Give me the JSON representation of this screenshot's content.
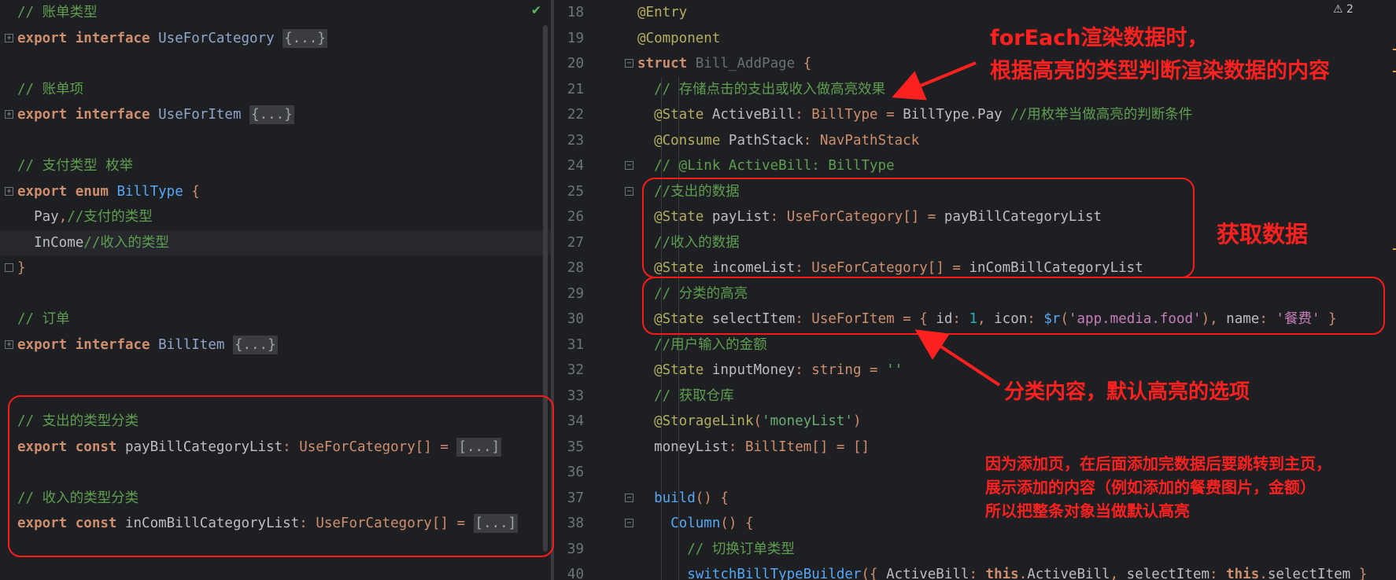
{
  "left_editor": {
    "lines": [
      [
        [
          "cm",
          "// 账单类型"
        ]
      ],
      [
        [
          "kw",
          "export "
        ],
        [
          "kw",
          "interface "
        ],
        [
          "ty",
          "UseForCategory "
        ],
        [
          "box",
          "{...}"
        ]
      ],
      [],
      [
        [
          "cm",
          "// 账单项"
        ]
      ],
      [
        [
          "kw",
          "export "
        ],
        [
          "kw",
          "interface "
        ],
        [
          "ty",
          "UseForItem "
        ],
        [
          "box",
          "{...}"
        ]
      ],
      [],
      [
        [
          "cm",
          "// 支付类型 枚举"
        ]
      ],
      [
        [
          "kw",
          "export "
        ],
        [
          "kw",
          "enum "
        ],
        [
          "fn",
          "BillType "
        ],
        [
          "op",
          "{"
        ]
      ],
      [
        [
          "tx",
          "  Pay"
        ],
        [
          "op",
          ","
        ],
        [
          "cm",
          "//支付的类型"
        ]
      ],
      [
        [
          "tx",
          "  InCome"
        ],
        [
          "cm",
          "//收入的类型"
        ]
      ],
      [
        [
          "op",
          "}"
        ]
      ],
      [],
      [
        [
          "cm",
          "// 订单"
        ]
      ],
      [
        [
          "kw",
          "export "
        ],
        [
          "kw",
          "interface "
        ],
        [
          "ty",
          "BillItem "
        ],
        [
          "box",
          "{...}"
        ]
      ],
      [],
      [],
      [
        [
          "cm",
          "// 支出的类型分类"
        ]
      ],
      [
        [
          "kw",
          "export "
        ],
        [
          "kw",
          "const "
        ],
        [
          "tx",
          "payBillCategoryList"
        ],
        [
          "op",
          ": "
        ],
        [
          "kw2",
          "UseForCategory"
        ],
        [
          "op",
          "[] = "
        ],
        [
          "box",
          "[...]"
        ]
      ],
      [],
      [
        [
          "cm",
          "// 收入的类型分类"
        ]
      ],
      [
        [
          "kw",
          "export "
        ],
        [
          "kw",
          "const "
        ],
        [
          "tx",
          "inComBillCategoryList"
        ],
        [
          "op",
          ": "
        ],
        [
          "kw2",
          "UseForCategory"
        ],
        [
          "op",
          "[] = "
        ],
        [
          "box",
          "[...]"
        ]
      ]
    ]
  },
  "right_editor": {
    "lines": [
      {
        "n": "18",
        "t": [
          [
            "an",
            "@Entry"
          ]
        ]
      },
      {
        "n": "19",
        "t": [
          [
            "an",
            "@Component"
          ]
        ]
      },
      {
        "n": "20",
        "t": [
          [
            "kw",
            "struct "
          ],
          [
            "dty",
            "Bill_AddPage "
          ],
          [
            "op",
            "{"
          ]
        ]
      },
      {
        "n": "21",
        "t": [
          [
            "tx",
            "  "
          ],
          [
            "cm",
            "// 存储点击的支出或收入做高亮效果"
          ]
        ]
      },
      {
        "n": "22",
        "t": [
          [
            "tx",
            "  "
          ],
          [
            "an",
            "@State "
          ],
          [
            "tx",
            "ActiveBill"
          ],
          [
            "op",
            ": "
          ],
          [
            "kw2",
            "BillType "
          ],
          [
            "op",
            "= "
          ],
          [
            "tx",
            "BillType"
          ],
          [
            "op",
            "."
          ],
          [
            "tx",
            "Pay "
          ],
          [
            "cm",
            "//用枚举当做高亮的判断条件"
          ]
        ]
      },
      {
        "n": "23",
        "t": [
          [
            "tx",
            "  "
          ],
          [
            "an",
            "@Consume "
          ],
          [
            "tx",
            "PathStack"
          ],
          [
            "op",
            ": "
          ],
          [
            "kw2",
            "NavPathStack"
          ]
        ]
      },
      {
        "n": "24",
        "t": [
          [
            "tx",
            "  "
          ],
          [
            "cm",
            "// @Link ActiveBill: BillType"
          ]
        ]
      },
      {
        "n": "25",
        "t": [
          [
            "tx",
            "  "
          ],
          [
            "cm",
            "//支出的数据"
          ]
        ]
      },
      {
        "n": "26",
        "t": [
          [
            "tx",
            "  "
          ],
          [
            "an",
            "@State "
          ],
          [
            "tx",
            "payList"
          ],
          [
            "op",
            ": "
          ],
          [
            "kw2",
            "UseForCategory"
          ],
          [
            "op",
            "[] = "
          ],
          [
            "tx",
            "payBillCategoryList"
          ]
        ]
      },
      {
        "n": "27",
        "t": [
          [
            "tx",
            "  "
          ],
          [
            "cm",
            "//收入的数据"
          ]
        ]
      },
      {
        "n": "28",
        "t": [
          [
            "tx",
            "  "
          ],
          [
            "an",
            "@State "
          ],
          [
            "tx",
            "incomeList"
          ],
          [
            "op",
            ": "
          ],
          [
            "kw2",
            "UseForCategory"
          ],
          [
            "op",
            "[] = "
          ],
          [
            "tx",
            "inComBillCategoryList"
          ]
        ]
      },
      {
        "n": "29",
        "t": [
          [
            "tx",
            "  "
          ],
          [
            "cm",
            "// 分类的高亮"
          ]
        ]
      },
      {
        "n": "30",
        "t": [
          [
            "tx",
            "  "
          ],
          [
            "an",
            "@State "
          ],
          [
            "tx",
            "selectItem"
          ],
          [
            "op",
            ": "
          ],
          [
            "kw2",
            "UseForItem "
          ],
          [
            "op",
            "= { "
          ],
          [
            "tx",
            "id"
          ],
          [
            "op",
            ": "
          ],
          [
            "num",
            "1"
          ],
          [
            "op",
            ", "
          ],
          [
            "tx",
            "icon"
          ],
          [
            "op",
            ": "
          ],
          [
            "fn",
            "$r"
          ],
          [
            "op",
            "("
          ],
          [
            "str2",
            "'app.media.food'"
          ],
          [
            "op",
            "), "
          ],
          [
            "tx",
            "name"
          ],
          [
            "op",
            ": "
          ],
          [
            "str2",
            "'餐费' "
          ],
          [
            "op",
            "}"
          ]
        ]
      },
      {
        "n": "31",
        "t": [
          [
            "tx",
            "  "
          ],
          [
            "cm",
            "//用户输入的金额"
          ]
        ]
      },
      {
        "n": "32",
        "t": [
          [
            "tx",
            "  "
          ],
          [
            "an",
            "@State "
          ],
          [
            "tx",
            "inputMoney"
          ],
          [
            "op",
            ": "
          ],
          [
            "kw2",
            "string "
          ],
          [
            "op",
            "= "
          ],
          [
            "str",
            "''"
          ]
        ]
      },
      {
        "n": "33",
        "t": [
          [
            "tx",
            "  "
          ],
          [
            "cm",
            "// 获取仓库"
          ]
        ]
      },
      {
        "n": "34",
        "t": [
          [
            "tx",
            "  "
          ],
          [
            "an",
            "@StorageLink"
          ],
          [
            "op",
            "("
          ],
          [
            "str",
            "'moneyList'"
          ],
          [
            "op",
            ")"
          ]
        ]
      },
      {
        "n": "35",
        "t": [
          [
            "tx",
            "  moneyList"
          ],
          [
            "op",
            ": "
          ],
          [
            "kw2",
            "BillItem"
          ],
          [
            "op",
            "[] = []"
          ]
        ]
      },
      {
        "n": "36",
        "t": []
      },
      {
        "n": "37",
        "t": [
          [
            "tx",
            "  "
          ],
          [
            "fn",
            "build"
          ],
          [
            "op",
            "() {"
          ]
        ]
      },
      {
        "n": "38",
        "t": [
          [
            "tx",
            "    "
          ],
          [
            "fn",
            "Column"
          ],
          [
            "op",
            "() {"
          ]
        ]
      },
      {
        "n": "39",
        "t": [
          [
            "tx",
            "      "
          ],
          [
            "cm",
            "// 切换订单类型"
          ]
        ]
      },
      {
        "n": "40",
        "t": [
          [
            "tx",
            "      "
          ],
          [
            "fn",
            "switchBillTypeBuilder"
          ],
          [
            "op",
            "({ "
          ],
          [
            "tx",
            "ActiveBill"
          ],
          [
            "op",
            ": "
          ],
          [
            "kw",
            "this"
          ],
          [
            "op",
            "."
          ],
          [
            "tx",
            "ActiveBill"
          ],
          [
            "op",
            ", "
          ],
          [
            "tx",
            "selectItem"
          ],
          [
            "op",
            ": "
          ],
          [
            "kw",
            "this"
          ],
          [
            "op",
            "."
          ],
          [
            "tx",
            "selectItem "
          ],
          [
            "op",
            "}"
          ]
        ]
      }
    ]
  },
  "annotations": {
    "foreach_line1": "forEach渲染数据时，",
    "foreach_line2": "根据高亮的类型判断渲染数据的内容",
    "get_data": "获取数据",
    "category": "分类内容，默认高亮的选项",
    "note_line1": "因为添加页，在后面添加完数据后要跳转到主页，",
    "note_line2": "展示添加的内容（例如添加的餐费图片，金额）",
    "note_line3": "所以把整条对象当做默认高亮"
  },
  "status": {
    "warning_count": "⚠ 2",
    "check_icon": "✔"
  },
  "colors": {
    "annotation_red": "#ff2020",
    "editor_bg": "#1e1f22",
    "keyword": "#cf8e6d",
    "comment": "#5f9e50"
  }
}
